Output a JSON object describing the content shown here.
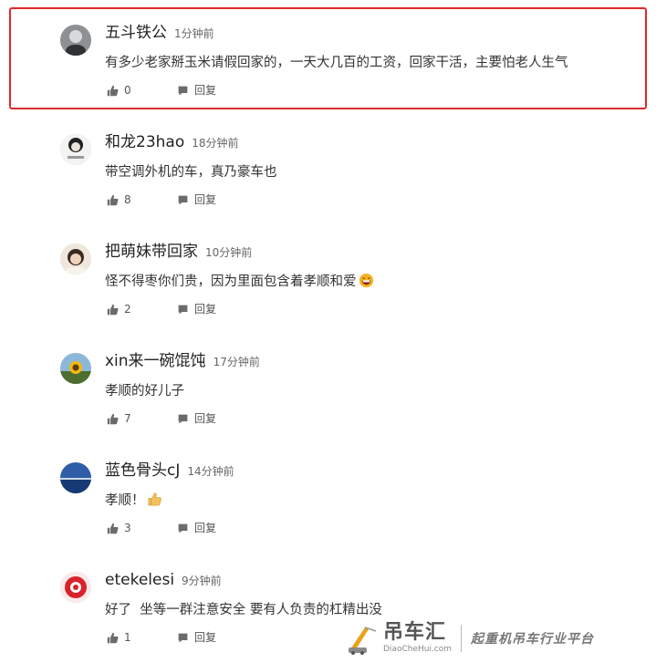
{
  "comments": [
    {
      "name": "五斗铁公",
      "time": "1分钟前",
      "text": "有多少老家掰玉米请假回家的，一天大几百的工资，回家干活，主要怕老人生气",
      "likes": "0",
      "reply": "回复",
      "avatar": "gray-figure-avatar"
    },
    {
      "name": "和龙23hao",
      "time": "18分钟前",
      "text": "带空调外机的车，真乃豪车也",
      "likes": "8",
      "reply": "回复",
      "avatar": "cartoon-man-avatar"
    },
    {
      "name": "把萌妹带回家",
      "time": "10分钟前",
      "text": "怪不得枣你们贵，因为里面包含着孝顺和爱",
      "likes": "2",
      "reply": "回复",
      "avatar": "girl-photo-avatar",
      "emoji": "grinning-emoji"
    },
    {
      "name": "xin来一碗馄饨",
      "time": "17分钟前",
      "text": "孝顺的好儿子",
      "likes": "7",
      "reply": "回复",
      "avatar": "sunflower-avatar"
    },
    {
      "name": "蓝色骨头cJ",
      "time": "14分钟前",
      "text": "孝顺！",
      "likes": "3",
      "reply": "回复",
      "avatar": "sea-landscape-avatar",
      "emoji": "thumbs-up-emoji"
    },
    {
      "name": "etekelesi",
      "time": "9分钟前",
      "text": "好了  坐等一群注意安全 要有人负责的杠精出没",
      "likes": "1",
      "reply": "回复",
      "avatar": "red-badge-avatar"
    }
  ],
  "watermark": {
    "brand": "吊车汇",
    "url": "DiaoCheHui.com",
    "tagline": "起重机吊车行业平台"
  },
  "colors": {
    "highlight": "#e02a2a",
    "text": "#333333",
    "meta": "#666666"
  }
}
